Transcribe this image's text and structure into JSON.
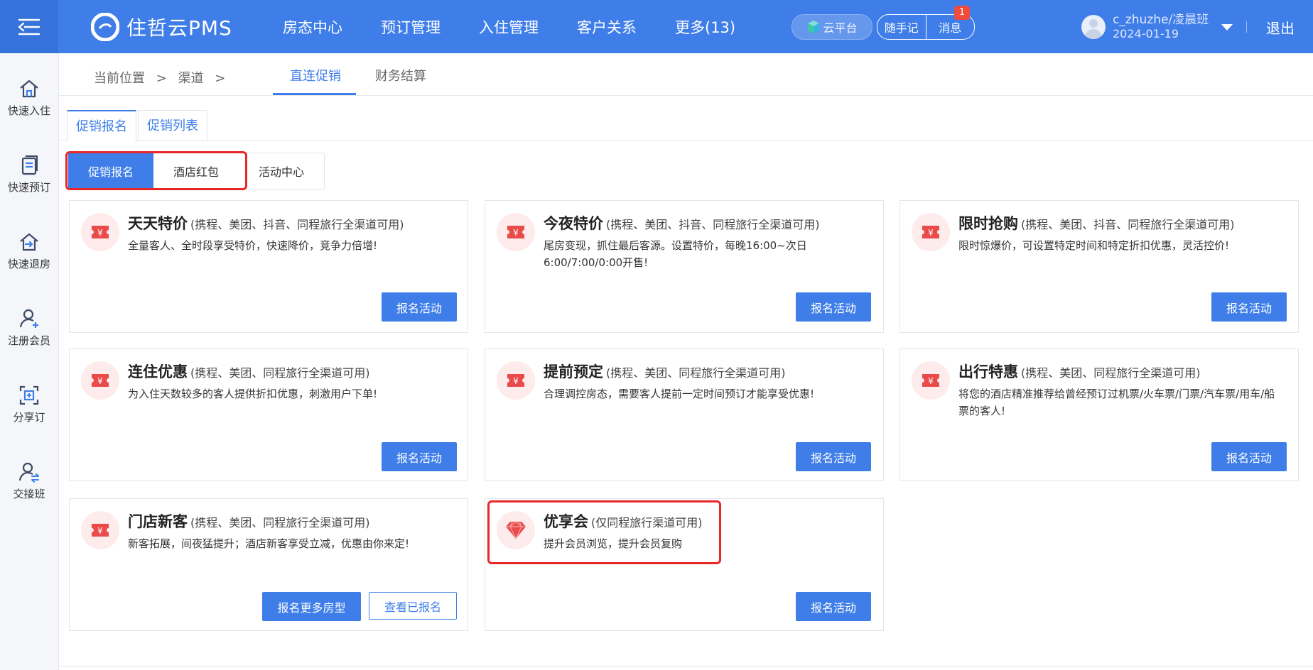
{
  "app": {
    "brand": "住哲云PMS",
    "nav": [
      "房态中心",
      "预订管理",
      "入住管理",
      "客户关系",
      "更多(13)"
    ],
    "cloud_label": "云平台",
    "note_label": "随手记",
    "message_label": "消息",
    "message_badge": "1",
    "user_name": "c_zhuzhe/凌晨班",
    "user_date": "2024-01-19",
    "logout": "退出",
    "accent": "#3f7ee8"
  },
  "sidebar": {
    "items": [
      {
        "label": "快速入住",
        "icon": "home-icon"
      },
      {
        "label": "快速预订",
        "icon": "document-icon"
      },
      {
        "label": "快速退房",
        "icon": "checkout-icon"
      },
      {
        "label": "注册会员",
        "icon": "user-add-icon"
      },
      {
        "label": "分享订",
        "icon": "share-icon"
      },
      {
        "label": "交接班",
        "icon": "handover-icon"
      }
    ]
  },
  "breadcrumb": {
    "current": "当前位置",
    "sep": ">",
    "channel": "渠道"
  },
  "top_tabs": [
    "直连促销",
    "财务结算"
  ],
  "sub_tabs": [
    "促销报名",
    "促销列表"
  ],
  "segments": [
    "促销报名",
    "酒店红包",
    "活动中心"
  ],
  "cards": [
    {
      "title": "天天特价",
      "note": "(携程、美团、抖音、同程旅行全渠道可用)",
      "desc": "全量客人、全时段享受特价，快速降价，竞争力倍增!",
      "btn": "报名活动"
    },
    {
      "title": "今夜特价",
      "note": "(携程、美团、抖音、同程旅行全渠道可用)",
      "desc": "尾房变现，抓住最后客源。设置特价，每晚16:00~次日6:00/7:00/0:00开售!",
      "btn": "报名活动"
    },
    {
      "title": "限时抢购",
      "note": "(携程、美团、抖音、同程旅行全渠道可用)",
      "desc": "限时惊爆价，可设置特定时间和特定折扣优惠，灵活控价!",
      "btn": "报名活动"
    },
    {
      "title": "连住优惠",
      "note": "(携程、美团、同程旅行全渠道可用)",
      "desc": "为入住天数较多的客人提供折扣优惠，刺激用户下单!",
      "btn": "报名活动"
    },
    {
      "title": "提前预定",
      "note": "(携程、美团、同程旅行全渠道可用)",
      "desc": "合理调控房态，需要客人提前一定时间预订才能享受优惠!",
      "btn": "报名活动"
    },
    {
      "title": "出行特惠",
      "note": "(携程、美团、同程旅行全渠道可用)",
      "desc": "将您的酒店精准推荐给曾经预订过机票/火车票/门票/汽车票/用车/船票的客人!",
      "btn": "报名活动"
    },
    {
      "title": "门店新客",
      "note": "(携程、美团、同程旅行全渠道可用)",
      "desc": "新客拓展，间夜猛提升；酒店新客享受立减，优惠由你来定!",
      "btn": "报名更多房型",
      "btn2": "查看已报名"
    },
    {
      "title": "优享会",
      "note": "(仅同程旅行渠道可用)",
      "desc": "提升会员浏览，提升会员复购",
      "btn": "报名活动"
    }
  ]
}
